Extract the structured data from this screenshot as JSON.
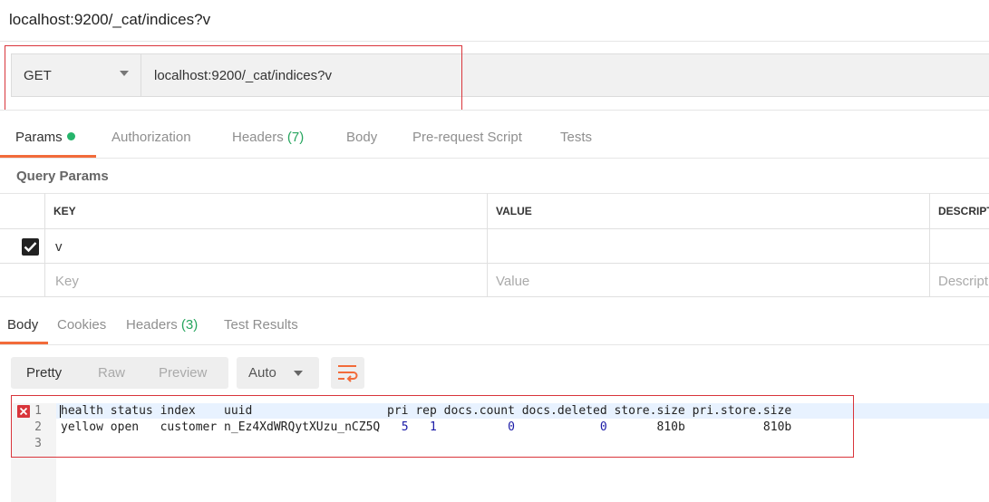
{
  "title": "localhost:9200/_cat/indices?v",
  "request": {
    "method": "GET",
    "url": "localhost:9200/_cat/indices?v"
  },
  "request_tabs": {
    "params": "Params",
    "authorization": "Authorization",
    "headers": "Headers",
    "headers_count": "(7)",
    "body": "Body",
    "pre_request_script": "Pre-request Script",
    "tests": "Tests"
  },
  "query_params": {
    "label": "Query Params",
    "columns": {
      "key": "KEY",
      "value": "VALUE",
      "description": "DESCRIPT"
    },
    "rows": [
      {
        "checked": true,
        "key": "v",
        "value": "",
        "description": ""
      }
    ],
    "placeholders": {
      "key": "Key",
      "value": "Value",
      "description": "Descript"
    }
  },
  "response_tabs": {
    "body": "Body",
    "cookies": "Cookies",
    "headers": "Headers",
    "headers_count": "(3)",
    "test_results": "Test Results"
  },
  "view": {
    "pretty": "Pretty",
    "raw": "Raw",
    "preview": "Preview",
    "format": "Auto"
  },
  "editor": {
    "line_numbers": [
      "1",
      "2",
      "3"
    ],
    "header_line": "health status index    uuid                   pri rep docs.count docs.deleted store.size pri.store.size",
    "row": {
      "health": "yellow",
      "status": "open",
      "index": "customer",
      "uuid": "n_Ez4XdWRQytXUzu_nCZ5Q",
      "pri": "5",
      "rep": "1",
      "docs_count": "0",
      "docs_deleted": "0",
      "store_size": "810b",
      "pri_store_size": "810b"
    }
  },
  "colors": {
    "accent": "#f26b3a",
    "highlight_box": "#d9353b",
    "dot": "#26b46b",
    "count": "#26a55e",
    "number": "#1a1aa6"
  }
}
